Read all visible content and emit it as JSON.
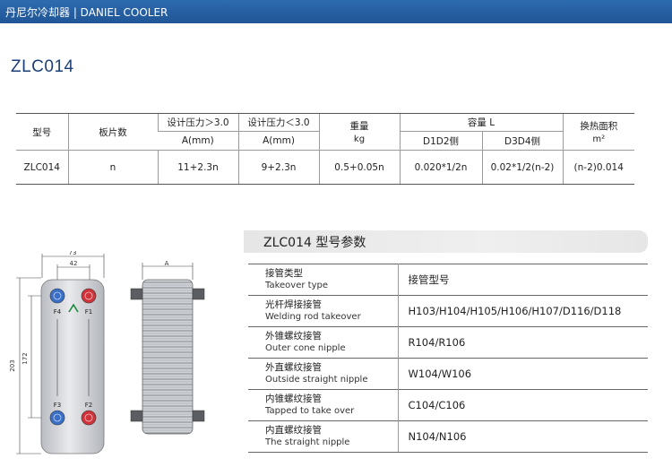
{
  "header": {
    "brand": "丹尼尔冷却器 | DANIEL COOLER"
  },
  "model_title": "ZLC014",
  "spec_table": {
    "col_model": "型号",
    "col_plates": "板片数",
    "col_design_ge": "设计压力＞3.0",
    "col_design_le": "设计压力＜3.0",
    "col_weight": "重量",
    "col_weight_unit": "kg",
    "col_volume": "容量  L",
    "col_area": "换热面积",
    "col_area_unit": "m²",
    "sub_a1": "A(mm)",
    "sub_a2": "A(mm)",
    "sub_d1d2": "D1D2侧",
    "sub_d3d4": "D3D4侧",
    "row": {
      "model": "ZLC014",
      "plates": "n",
      "a_ge": "11+2.3n",
      "a_le": "9+2.3n",
      "weight": "0.5+0.05n",
      "vol_d1d2": "0.020*1/2n",
      "vol_d3d4": "0.02*1/2(n-2)",
      "area": "(n-2)0.014"
    }
  },
  "params": {
    "title": "ZLC014 型号参数",
    "rows": [
      {
        "cn": "接管类型",
        "en": "Takeover type",
        "value": "接管型号"
      },
      {
        "cn": "光杆焊接接管",
        "en": "Welding rod takeover",
        "value": "H103/H104/H105/H106/H107/D116/D118"
      },
      {
        "cn": "外锥螺纹接管",
        "en": "Outer cone nipple",
        "value": "R104/R106"
      },
      {
        "cn": "外直螺纹接管",
        "en": "Outside straight nipple",
        "value": "W104/W106"
      },
      {
        "cn": "内锥螺纹接管",
        "en": "Tapped to take over",
        "value": "C104/C106"
      },
      {
        "cn": "内直螺纹接管",
        "en": "The straight nipple",
        "value": "N104/N106"
      }
    ]
  },
  "drawing": {
    "dim_width": "73",
    "dim_port_spacing": "42",
    "dim_height": "203",
    "dim_port_height": "172",
    "port_f4": "F4",
    "port_f1": "F1",
    "port_f3": "F3",
    "port_f2": "F2",
    "side_dim": "A",
    "colors": {
      "blue_port": "#3a6fc8",
      "red_port": "#d0323a"
    }
  }
}
